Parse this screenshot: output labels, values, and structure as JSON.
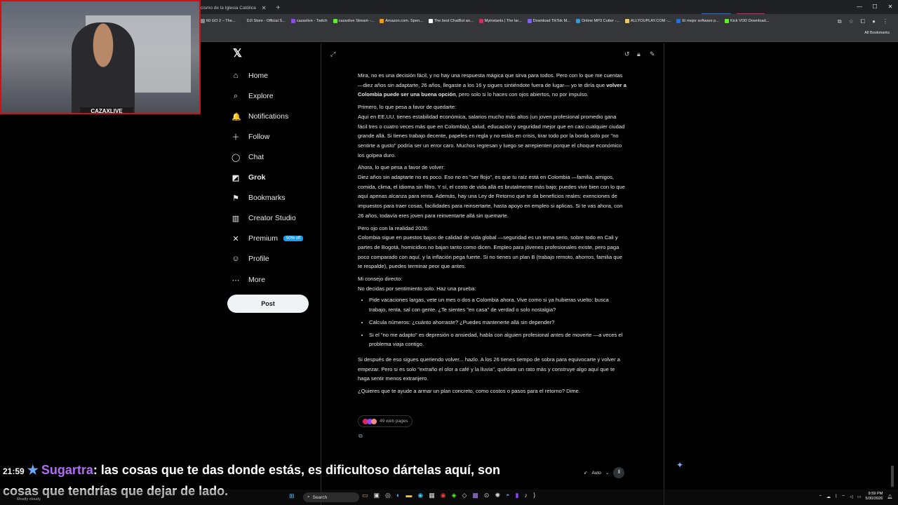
{
  "browser": {
    "tab_title": "cismo de la Iglesia Católica",
    "bookmarks": [
      {
        "label": "60 GO 2 – The...",
        "color": "#888888"
      },
      {
        "label": "DJI Store - Official S...",
        "color": "#333333"
      },
      {
        "label": "cazaxlive - Twitch",
        "color": "#9146ff"
      },
      {
        "label": "cazaxlive Stream -...",
        "color": "#53fc18"
      },
      {
        "label": "Amazon.com. Spen...",
        "color": "#ff9900"
      },
      {
        "label": "The best ChatBot an...",
        "color": "#ffffff"
      },
      {
        "label": "Myinstants | The lar...",
        "color": "#e0245e"
      },
      {
        "label": "Download TikTok M...",
        "color": "#7a5cff"
      },
      {
        "label": "Online MP3 Cutter -...",
        "color": "#2d9cdb"
      },
      {
        "label": "ALLYOUPLAY.COM -...",
        "color": "#f2c94c"
      },
      {
        "label": "El mejor software p...",
        "color": "#1a73e8"
      },
      {
        "label": "Kick VOD Download...",
        "color": "#53fc18"
      }
    ],
    "all_bookmarks": "All Bookmarks"
  },
  "webcam": {
    "name": "CAZAXLIVE"
  },
  "nav": {
    "items": [
      {
        "label": "Home",
        "icon": "⌂"
      },
      {
        "label": "Explore",
        "icon": "⌕"
      },
      {
        "label": "Notifications",
        "icon": "🔔"
      },
      {
        "label": "Follow",
        "icon": "＋"
      },
      {
        "label": "Chat",
        "icon": "◯"
      },
      {
        "label": "Grok",
        "icon": "◩"
      },
      {
        "label": "Bookmarks",
        "icon": "⚑"
      },
      {
        "label": "Creator Studio",
        "icon": "▥"
      },
      {
        "label": "Premium",
        "icon": "✕"
      },
      {
        "label": "Profile",
        "icon": "☺"
      },
      {
        "label": "More",
        "icon": "⋯"
      }
    ],
    "premium_badge": "50% off",
    "post_label": "Post"
  },
  "answer": {
    "p1_a": "Mira, no es una decisión fácil, y no hay una respuesta mágica que sirva para todos. Pero con lo que me cuentas —diez años sin adaptarte, 26 años, llegaste a los 16 y sigues sintiéndote fuera de lugar— yo te diría que ",
    "p1_b": "volver a Colombia puede ser una buena opción",
    "p1_c": ", pero solo si lo haces con ojos abiertos, no por impulso.",
    "h2": "Primero, lo que pesa a favor de quedarte:",
    "p2": "Aquí en EE.UU. tienes estabilidad económica, salarios mucho más altos (un joven profesional promedio gana fácil tres o cuatro veces más que en Colombia), salud, educación y seguridad mejor que en casi cualquier ciudad grande allá. Si tienes trabajo decente, papeles en regla y no estás en crisis, tirar todo por la borda solo por \"no sentirte a gusto\" podría ser un error caro. Muchos regresan y luego se arrepienten porque el choque económico los golpea duro.",
    "h3": "Ahora, lo que pesa a favor de volver:",
    "p3": "Diez años sin adaptarte no es poco. Eso no es \"ser flojo\", es que tu raíz está en Colombia —familia, amigos, comida, clima, el idioma sin filtro. Y sí, el costo de vida allá es brutalmente más bajo: puedes vivir bien con lo que aquí apenas alcanza para renta. Además, hay una Ley de Retorno que te da beneficios reales: exenciones de impuestos para traer cosas, facilidades para reinsertarte, hasta apoyo en empleo si aplicas. Si te vas ahora, con 26 años, todavía eres joven para reinventarte allá sin quemarte.",
    "h4": "Pero ojo con la realidad 2026:",
    "p4": "Colombia sigue en puestos bajos de calidad de vida global —seguridad es un tema serio, sobre todo en Cali y partes de Bogotá, homicidios no bajan tanto como dicen. Empleo para jóvenes profesionales existe, pero paga poco comparado con aquí, y la inflación pega fuerte. Si no tienes un plan B (trabajo remoto, ahorros, familia que te respalde), puedes terminar peor que antes.",
    "h5": "Mi consejo directo:",
    "h5b": "No decidas por sentimiento solo. Haz una prueba:",
    "bullets": [
      "Pide vacaciones largas, vete un mes o dos a Colombia ahora. Vive como si ya hubieras vuelto: busca trabajo, renta, sal con gente. ¿Te sientes \"en casa\" de verdad o solo nostalgia?",
      "Calcula números: ¿cuánto ahorraste? ¿Puedes mantenerte allá sin depender?",
      "Si el \"no me adapto\" es depresión o ansiedad, habla con alguien profesional antes de moverte —a veces el problema viaja contigo."
    ],
    "p6": "Si después de eso sigues queriendo volver... hazlo. A los 26 tienes tiempo de sobra para equivocarte y volver a empezar. Pero si es solo \"extraño el olor a café y la lluvia\", quédate un rato más y construye algo aquí que te haga sentir menos extranjero.",
    "p7": "¿Quieres que te ayude a armar un plan concreto, como costos o pasos para el retorno? Dime.",
    "sources": "49 web pages"
  },
  "input": {
    "mode": "Auto"
  },
  "chat": {
    "time": "21:59",
    "user": "Sugartra",
    "line1": ": las cosas que te das donde estás, es dificultoso dártelas aquí, son",
    "line2": "cosas que tendrías que dejar de lado."
  },
  "taskbar": {
    "search": "Search",
    "weather": "Mostly cloudy",
    "time": "9:59 PM",
    "date": "5/30/2026"
  }
}
